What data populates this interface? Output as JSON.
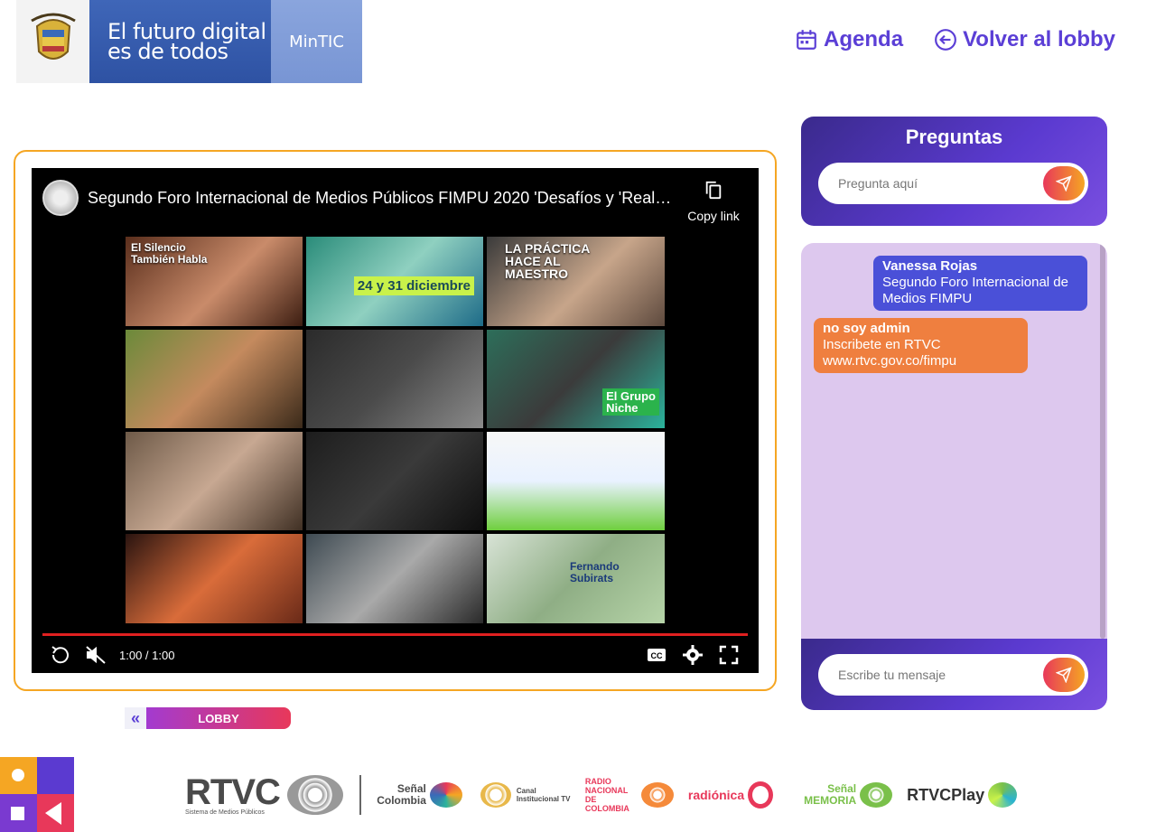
{
  "header": {
    "banner_slogan_line1": "El futuro digital",
    "banner_slogan_line2": "es de todos",
    "banner_ministry": "MinTIC",
    "nav": {
      "agenda_label": "Agenda",
      "lobby_label": "Volver al lobby"
    }
  },
  "video": {
    "title": "Segundo Foro Internacional de Medios Públicos FIMPU 2020 'Desafíos y 'Realid…",
    "copy_link_label": "Copy link",
    "time_display": "1:00 / 1:00",
    "progress_fraction": 1.0,
    "thumbnails": [
      {
        "caption": "El Silencio\nTambién Habla"
      },
      {
        "caption": "24 y 31 diciembre"
      },
      {
        "caption": "LA PRÁCTICA\nHACE AL\nMAESTRO"
      },
      {
        "caption": ""
      },
      {
        "caption": ""
      },
      {
        "caption": "El Grupo\nNiche"
      },
      {
        "caption": ""
      },
      {
        "caption": ""
      },
      {
        "caption": ""
      },
      {
        "caption": ""
      },
      {
        "caption": ""
      },
      {
        "caption": "Fernando\nSubirats"
      }
    ]
  },
  "lobby_button": {
    "label": "LOBBY"
  },
  "questions": {
    "title": "Preguntas",
    "placeholder": "Pregunta aquí"
  },
  "chat": {
    "messages": [
      {
        "author": "Vanessa Rojas",
        "text": "Segundo Foro Internacional de Medios FIMPU"
      },
      {
        "author": "no soy admin",
        "text": "Inscribete en RTVC www.rtvc.gov.co/fimpu"
      }
    ],
    "placeholder": "Escribe tu mensaje"
  },
  "footer_logos": {
    "rtvc": "RTVC",
    "rtvc_sub": "Sistema de Medios Públicos",
    "senal_colombia": "Señal Colombia",
    "canal_institucional": "Canal Institucional TV",
    "radio_nacional": "RADIO NACIONAL DE COLOMBIA",
    "radionica": "radiónica",
    "senal_memoria": "Señal MEMORIA",
    "rtvc_play": "RTVCPlay"
  },
  "colors": {
    "accent_purple": "#5b3fd6",
    "frame_orange": "#f5a623",
    "bubble_blue": "#4a50d8",
    "bubble_orange": "#ef7f3f"
  }
}
